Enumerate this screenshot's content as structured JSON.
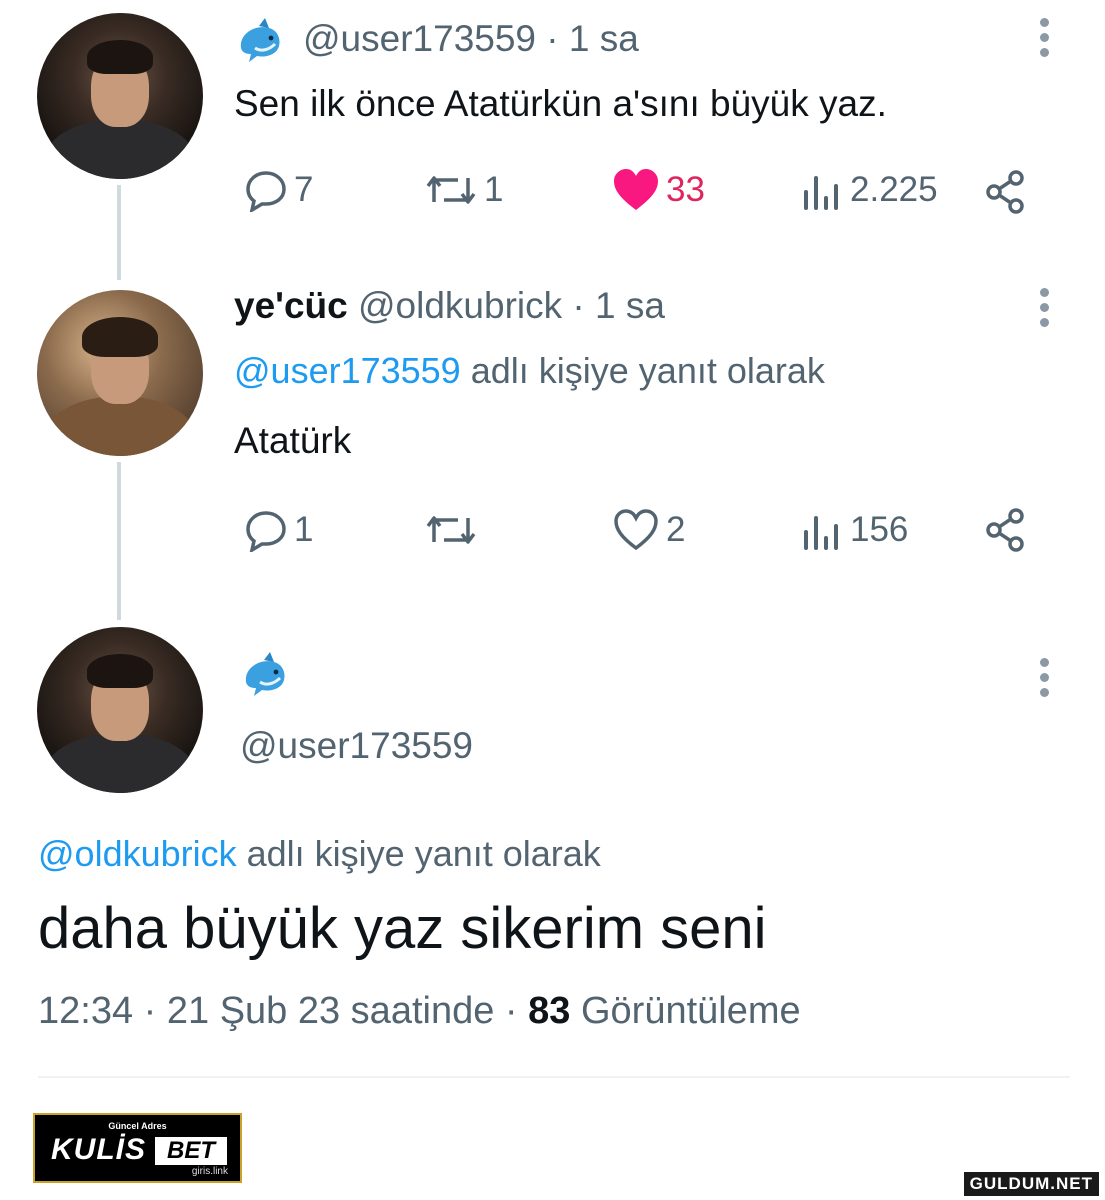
{
  "colors": {
    "accent": "#1d9bf0",
    "like": "#e0245e",
    "muted": "#536471"
  },
  "tweets": [
    {
      "handle": "@user173559",
      "time": "· 1 sa",
      "text": "Sen ilk önce Atatürkün a'sını büyük yaz.",
      "replies": "7",
      "retweets": "1",
      "likes": "33",
      "views": "2.225"
    },
    {
      "name": "ye'cüc",
      "handle": "@oldkubrick",
      "time": "· 1 sa",
      "reply_mention": "@user173559",
      "reply_suffix": "adlı kişiye yanıt olarak",
      "text": "Atatürk",
      "replies": "1",
      "retweets": "",
      "likes": "2",
      "views": "156"
    }
  ],
  "main_tweet": {
    "handle": "@user173559",
    "reply_mention": "@oldkubrick",
    "reply_suffix": "adlı kişiye yanıt olarak",
    "text": "daha büyük yaz sikerim seni",
    "timestamp": "12:34 · 21 Şub 23 saatinde ·",
    "views_count": "83",
    "views_label": "Görüntüleme"
  },
  "ad": {
    "top": "Güncel Adres",
    "brand": "KULİS",
    "brand2": "BET",
    "link": "giris.link"
  },
  "watermark": "GULDUM.NET"
}
